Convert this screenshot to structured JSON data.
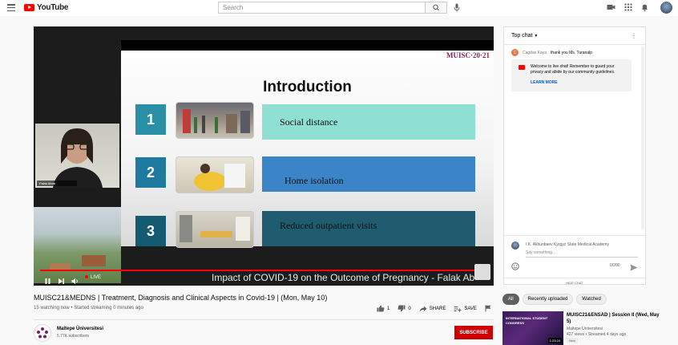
{
  "topbar": {
    "logo_text": "YouTube",
    "search_placeholder": "Search",
    "icons": [
      "menu-icon",
      "search-icon",
      "microphone-icon",
      "create-video-icon",
      "apps-grid-icon",
      "notifications-bell-icon"
    ]
  },
  "player": {
    "slide_title": "Introduction",
    "brand": "MUISC·20·21",
    "rows": [
      {
        "num": "1",
        "label": "Social distance",
        "color": "#8fe0d2"
      },
      {
        "num": "2",
        "label": "Home isolation",
        "color": "#3b84c7"
      },
      {
        "num": "3",
        "label": "Reduced outpatient visits",
        "color": "#1f5c70"
      }
    ],
    "cam_name": "Falak Abrar",
    "overlay_title": "Impact of COVID-19 on the Outcome of Pregnancy - Falak Ab",
    "live_label": "LIVE"
  },
  "video": {
    "title": "MUISC21&MEDNS | Treatment, Diagnosis and Clinical Aspects in Covid-19 | (Mon, May 10)",
    "meta": "15 watching now • Started streaming 0 minutes ago",
    "likes": "1",
    "dislikes": "0",
    "share_label": "SHARE",
    "save_label": "SAVE"
  },
  "channel": {
    "name": "Maltepe Üniversitesi",
    "subscribers": "5.77K subscribers",
    "subscribe_label": "SUBSCRIBE"
  },
  "chat": {
    "header": "Top chat",
    "messages": [
      {
        "initial": "C",
        "author": "Cagdas Kaya",
        "text": "thank you Ms. Turanalp"
      }
    ],
    "welcome_text": "Welcome to live chat! Remember to guard your privacy and abide by our community guidelines.",
    "learn_more": "LEARN MORE",
    "input_user": "I.K. Akhunbaev Kyrgyz State Medical Academy",
    "input_placeholder": "Say something...",
    "char_count": "0/200",
    "hide_chat": "HIDE CHAT"
  },
  "chips": [
    "All",
    "Recently uploaded",
    "Watched"
  ],
  "recommendation": {
    "title": "MUISC21&ENSAD | Session II (Wed, May 5)",
    "channel": "Maltepe Üniversitesi",
    "views": "427 views • Streamed 4 days ago",
    "badge": "New",
    "duration": "1:23:24",
    "thumb_text": "INTERNATIONAL STUDENT CONGRESS"
  }
}
